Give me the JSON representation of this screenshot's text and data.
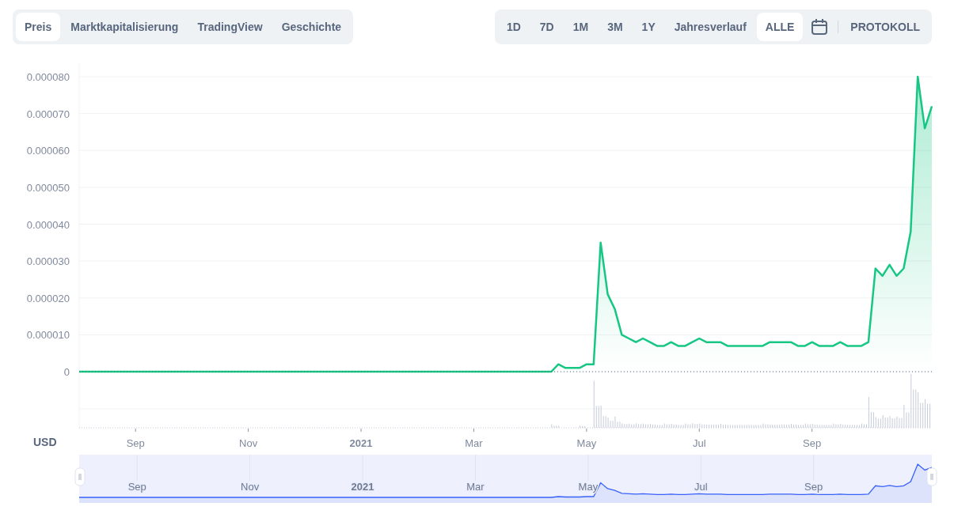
{
  "tabs": [
    {
      "label": "Preis",
      "selected": true
    },
    {
      "label": "Marktkapitalisierung",
      "selected": false
    },
    {
      "label": "TradingView",
      "selected": false
    },
    {
      "label": "Geschichte",
      "selected": false
    }
  ],
  "ranges": [
    {
      "label": "1D",
      "selected": false
    },
    {
      "label": "7D",
      "selected": false
    },
    {
      "label": "1M",
      "selected": false
    },
    {
      "label": "3M",
      "selected": false
    },
    {
      "label": "1Y",
      "selected": false
    },
    {
      "label": "Jahresverlauf",
      "selected": false
    },
    {
      "label": "ALLE",
      "selected": true
    }
  ],
  "log_button": "PROTOKOLL",
  "chart": {
    "currency": "USD",
    "chart_data": {
      "type": "area",
      "grid": true,
      "ylim": [
        0,
        8e-05
      ],
      "yticks": [
        {
          "value": 0,
          "label": "0"
        },
        {
          "value": 1e-05,
          "label": "0.000010"
        },
        {
          "value": 2e-05,
          "label": "0.000020"
        },
        {
          "value": 3e-05,
          "label": "0.000030"
        },
        {
          "value": 4e-05,
          "label": "0.000040"
        },
        {
          "value": 5e-05,
          "label": "0.000050"
        },
        {
          "value": 6e-05,
          "label": "0.000060"
        },
        {
          "value": 7e-05,
          "label": "0.000070"
        },
        {
          "value": 8e-05,
          "label": "0.000080"
        }
      ],
      "categories": [
        null,
        null,
        null,
        null,
        null,
        null,
        null,
        null,
        "Sep",
        null,
        null,
        null,
        null,
        null,
        null,
        null,
        null,
        null,
        null,
        null,
        null,
        null,
        null,
        null,
        "Nov",
        null,
        null,
        null,
        null,
        null,
        null,
        null,
        null,
        null,
        null,
        null,
        null,
        null,
        null,
        null,
        "2021",
        null,
        null,
        null,
        null,
        null,
        null,
        null,
        null,
        null,
        null,
        null,
        null,
        null,
        null,
        null,
        "Mar",
        null,
        null,
        null,
        null,
        null,
        null,
        null,
        null,
        null,
        null,
        null,
        null,
        null,
        null,
        null,
        "May",
        null,
        null,
        null,
        null,
        null,
        null,
        null,
        null,
        null,
        null,
        null,
        null,
        null,
        null,
        null,
        "Jul",
        null,
        null,
        null,
        null,
        null,
        null,
        null,
        null,
        null,
        null,
        null,
        null,
        null,
        null,
        null,
        "Sep",
        null,
        null,
        null,
        null,
        null,
        null,
        null,
        null,
        null,
        null,
        null,
        null,
        null,
        null,
        null,
        null,
        null
      ],
      "series": [
        {
          "color": "#16c784",
          "values": [
            0,
            0,
            0,
            0,
            0,
            0,
            0,
            0,
            0,
            0,
            0,
            0,
            0,
            0,
            0,
            0,
            0,
            0,
            0,
            0,
            0,
            0,
            0,
            0,
            0,
            0,
            0,
            0,
            0,
            0,
            0,
            0,
            0,
            0,
            0,
            0,
            0,
            0,
            0,
            0,
            0,
            0,
            0,
            0,
            0,
            0,
            0,
            0,
            0,
            0,
            0,
            0,
            0,
            0,
            0,
            0,
            0,
            0,
            0,
            0,
            0,
            0,
            0,
            0,
            0,
            0,
            0,
            0,
            2e-06,
            1e-06,
            1e-06,
            1e-06,
            2e-06,
            2e-06,
            3.5e-05,
            2.1e-05,
            1.7e-05,
            1e-05,
            9e-06,
            8e-06,
            9e-06,
            8e-06,
            7e-06,
            7e-06,
            8e-06,
            7e-06,
            7e-06,
            8e-06,
            9e-06,
            8e-06,
            8e-06,
            8e-06,
            7e-06,
            7e-06,
            7e-06,
            7e-06,
            7e-06,
            7e-06,
            8e-06,
            8e-06,
            8e-06,
            8e-06,
            7e-06,
            7e-06,
            8e-06,
            7e-06,
            7e-06,
            7e-06,
            8e-06,
            7e-06,
            7e-06,
            7e-06,
            8e-06,
            2.8e-05,
            2.6e-05,
            2.9e-05,
            2.6e-05,
            2.8e-05,
            3.8e-05,
            8e-05,
            6.6e-05,
            7.2e-05
          ]
        }
      ]
    }
  },
  "navigator": {
    "labels": [
      "Sep",
      "Nov",
      "2021",
      "Mar",
      "May",
      "Jul",
      "Sep"
    ]
  }
}
